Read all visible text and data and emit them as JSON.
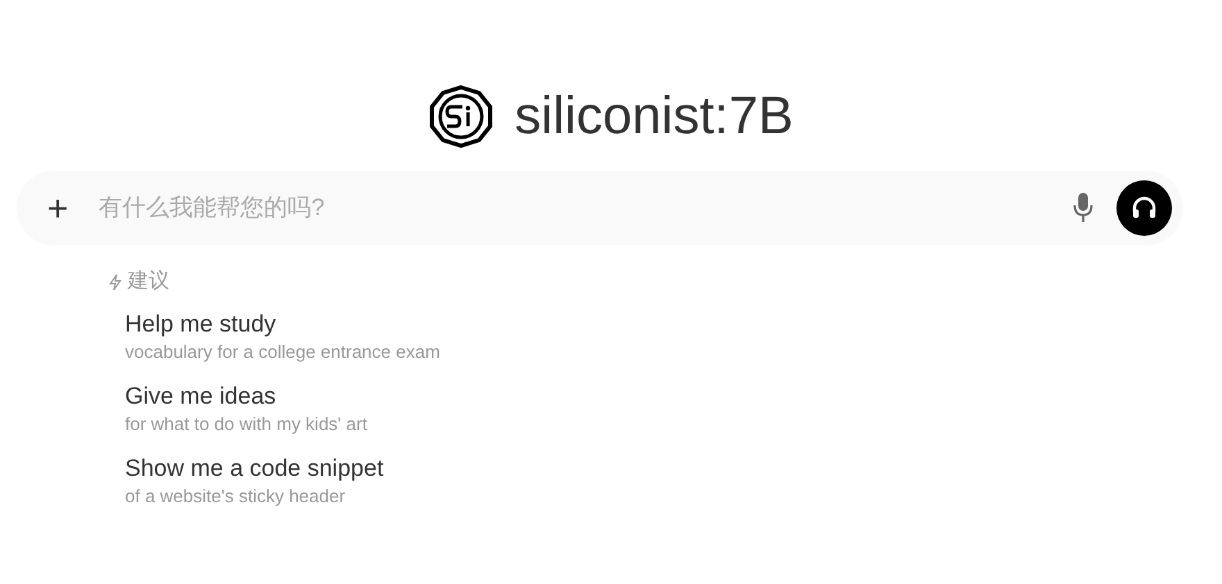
{
  "header": {
    "title": "siliconist:7B"
  },
  "composer": {
    "attach": "+",
    "placeholder": "有什么我能帮您的吗?"
  },
  "suggestions": {
    "label": "建议",
    "items": [
      {
        "title": "Help me study",
        "subtitle": "vocabulary for a college entrance exam"
      },
      {
        "title": "Give me ideas",
        "subtitle": "for what to do with my kids' art"
      },
      {
        "title": "Show me a code snippet",
        "subtitle": "of a website's sticky header"
      }
    ]
  }
}
